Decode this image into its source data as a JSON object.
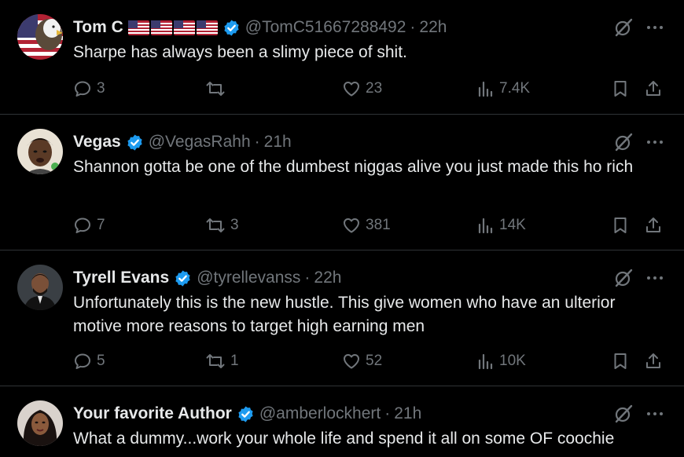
{
  "colors": {
    "background": "#000000",
    "text": "#e7e9ea",
    "muted": "#71767b",
    "verified": "#1d9bf0",
    "divider": "#2f3336"
  },
  "tweets": [
    {
      "name": "Tom C",
      "flags": [
        "us-flag",
        "us-flag",
        "us-flag",
        "us-flag"
      ],
      "handle": "@TomC51667288492",
      "sep": "·",
      "time": "22h",
      "text": "Sharpe has always been a slimy piece of shit.",
      "replies": "3",
      "retweets": "",
      "likes": "23",
      "views": "7.4K"
    },
    {
      "name": "Vegas",
      "handle": "@VegasRahh",
      "sep": "·",
      "time": "21h",
      "text": "Shannon gotta be one of the dumbest niggas alive you just made this ho rich",
      "replies": "7",
      "retweets": "3",
      "likes": "381",
      "views": "14K"
    },
    {
      "name": "Tyrell Evans",
      "handle": "@tyrellevanss",
      "sep": "·",
      "time": "22h",
      "text": "Unfortunately this is the new hustle. This give women who have an ulterior motive more reasons  to target high earning men",
      "replies": "5",
      "retweets": "1",
      "likes": "52",
      "views": "10K"
    },
    {
      "name": "Your favorite Author",
      "handle": "@amberlockhert",
      "sep": "·",
      "time": "21h",
      "text": "What a dummy...work your whole life and spend it all on some OF coochie"
    }
  ],
  "icons": {
    "verified": "verified-badge-icon",
    "grok": "grok-icon",
    "more": "more-icon",
    "reply": "reply-icon",
    "retweet": "retweet-icon",
    "like": "heart-icon",
    "views": "views-icon",
    "bookmark": "bookmark-icon",
    "share": "share-icon"
  }
}
